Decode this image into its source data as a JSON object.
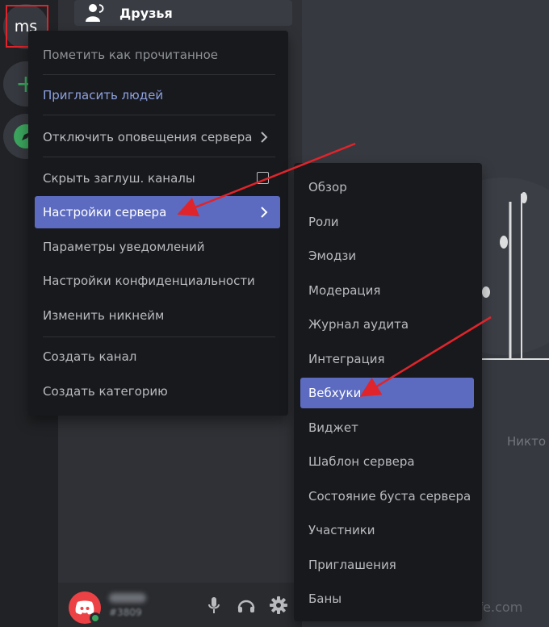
{
  "rail": {
    "server_abbr": "ms",
    "add_symbol": "+"
  },
  "channels": {
    "friends_label": "Друзья"
  },
  "context_menu": {
    "items": [
      {
        "label": "Пометить как прочитанное"
      },
      {
        "label": "Пригласить людей"
      },
      {
        "label": "Отключить оповещения сервера"
      },
      {
        "label": "Скрыть заглуш. каналы"
      },
      {
        "label": "Настройки сервера"
      },
      {
        "label": "Параметры уведомлений"
      },
      {
        "label": "Настройки конфиденциальности"
      },
      {
        "label": "Изменить никнейм"
      },
      {
        "label": "Создать канал"
      },
      {
        "label": "Создать категорию"
      }
    ]
  },
  "server_settings_submenu": {
    "items": [
      {
        "label": "Обзор"
      },
      {
        "label": "Роли"
      },
      {
        "label": "Эмодзи"
      },
      {
        "label": "Модерация"
      },
      {
        "label": "Журнал аудита"
      },
      {
        "label": "Интеграция"
      },
      {
        "label": "Вебхуки"
      },
      {
        "label": "Виджет"
      },
      {
        "label": "Шаблон сервера"
      },
      {
        "label": "Состояние буста сервера"
      },
      {
        "label": "Участники"
      },
      {
        "label": "Приглашения"
      },
      {
        "label": "Баны"
      }
    ]
  },
  "user_bar": {
    "tag": "#3809"
  },
  "main": {
    "empty_state_text": "Никто"
  },
  "watermark": "user-life.com",
  "colors": {
    "accent": "#5c6bc0",
    "annotation_red": "#e0242b",
    "online_green": "#3ba55d",
    "link_blue": "#8ea1e1"
  },
  "icons": {
    "friends": "friends-icon",
    "add_server": "plus-icon",
    "explore": "compass-icon",
    "avatar": "discord-logo-icon",
    "mic": "microphone-icon",
    "headphones": "headphones-icon",
    "settings": "gear-icon",
    "submenu_arrow": "chevron-right-icon",
    "checkbox": "checkbox-icon"
  }
}
